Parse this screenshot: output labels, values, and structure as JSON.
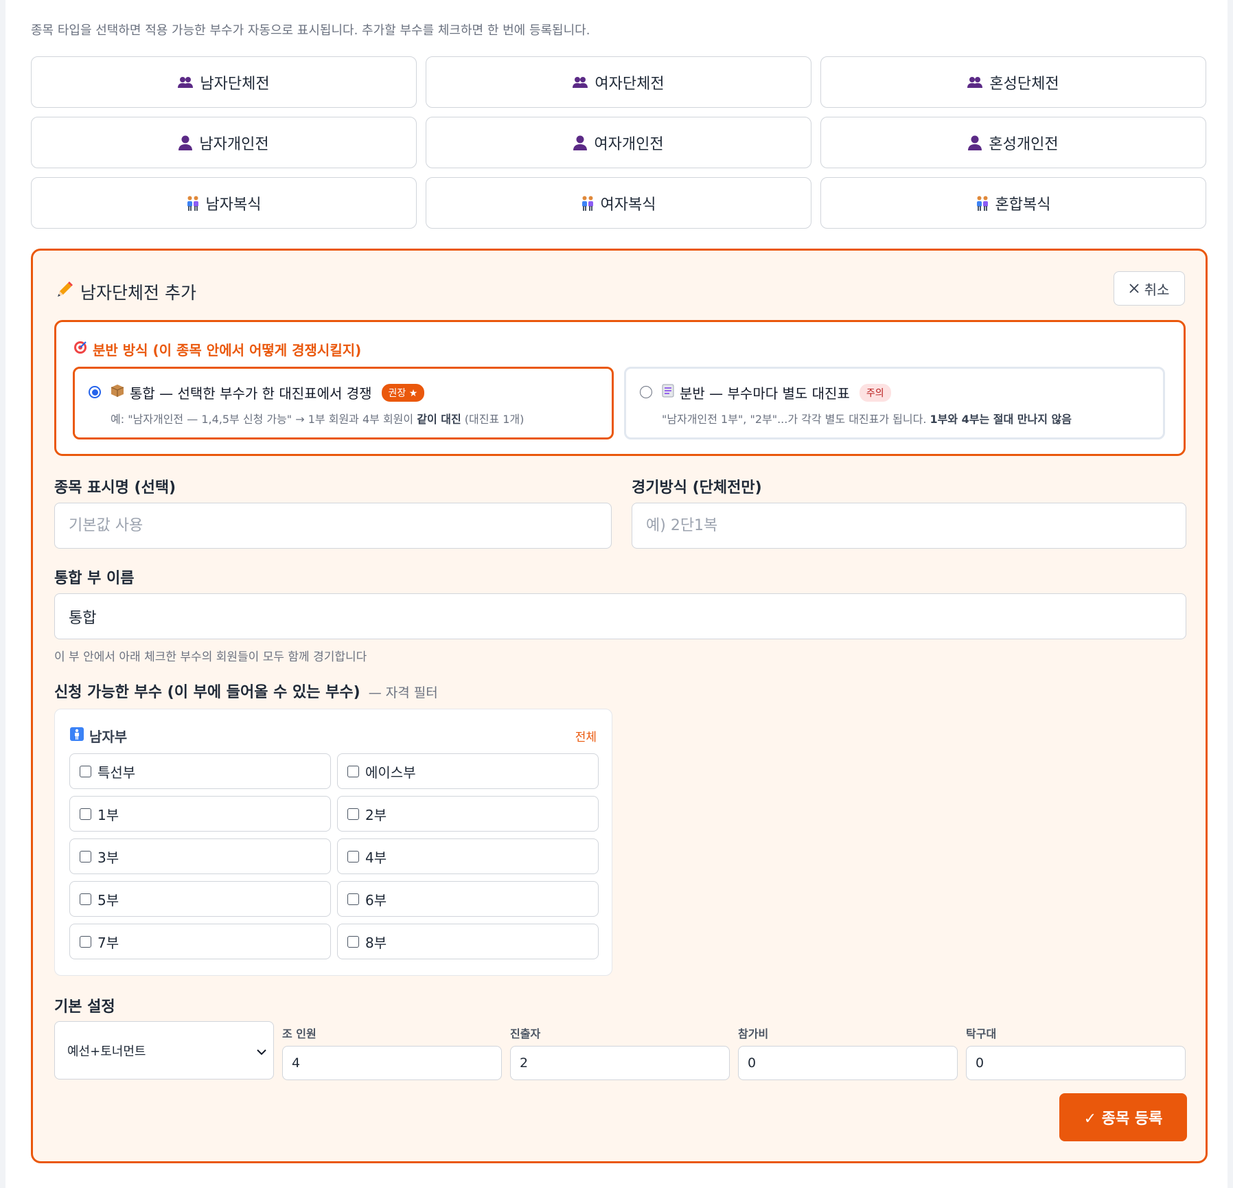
{
  "hint": "종목 타입을 선택하면 적용 가능한 부수가 자동으로 표시됩니다. 추가할 부수를 체크하면 한 번에 등록됩니다.",
  "event_types": [
    {
      "label": "남자단체전",
      "icon": "team-icon"
    },
    {
      "label": "여자단체전",
      "icon": "team-icon"
    },
    {
      "label": "혼성단체전",
      "icon": "team-icon"
    },
    {
      "label": "남자개인전",
      "icon": "person-icon"
    },
    {
      "label": "여자개인전",
      "icon": "person-icon"
    },
    {
      "label": "혼성개인전",
      "icon": "person-icon"
    },
    {
      "label": "남자복식",
      "icon": "pair-icon"
    },
    {
      "label": "여자복식",
      "icon": "pair-icon"
    },
    {
      "label": "혼합복식",
      "icon": "pair-icon"
    }
  ],
  "form": {
    "title": "남자단체전 추가",
    "cancel_label": "취소",
    "split": {
      "title": "분반 방식 (이 종목 안에서 어떻게 경쟁시킬지)",
      "option_a": {
        "head": "통합 — 선택한 부수가 한 대진표에서 경쟁",
        "badge": "권장 ★",
        "desc_pre": "예: \"남자개인전 — 1,4,5부 신청 가능\" → 1부 회원과 4부 회원이 ",
        "desc_bold": "같이 대진",
        "desc_post": " (대진표 1개)",
        "selected": true
      },
      "option_b": {
        "head": "분반 — 부수마다 별도 대진표",
        "badge": "주의",
        "desc_pre": "\"남자개인전 1부\", \"2부\"...가 각각 별도 대진표가 됩니다. ",
        "desc_bold": "1부와 4부는 절대 만나지 않음",
        "selected": false
      }
    },
    "display_name": {
      "label": "종목 표시명 (선택)",
      "placeholder": "기본값 사용",
      "value": ""
    },
    "match_format": {
      "label": "경기방식 (단체전만)",
      "placeholder": "예) 2단1복",
      "value": ""
    },
    "group_name": {
      "label": "통합 부 이름",
      "value": "통합",
      "help": "이 부 안에서 아래 체크한 부수의 회원들이 모두 함께 경기합니다"
    },
    "eligible": {
      "label": "신청 가능한 부수 (이 부에 들어올 수 있는 부수)",
      "sublabel": "— 자격 필터",
      "group_title": "남자부",
      "all_label": "전체",
      "divisions": [
        "특선부",
        "에이스부",
        "1부",
        "2부",
        "3부",
        "4부",
        "5부",
        "6부",
        "7부",
        "8부"
      ]
    },
    "basic": {
      "label": "기본 설정",
      "mode": "예선+토너먼트",
      "fields": [
        {
          "label": "조 인원",
          "value": "4"
        },
        {
          "label": "진출자",
          "value": "2"
        },
        {
          "label": "참가비",
          "value": "0"
        },
        {
          "label": "탁구대",
          "value": "0"
        }
      ]
    },
    "submit_label": "✓ 종목 등록"
  },
  "colors": {
    "accent": "#ea580c",
    "icon_purple": "#5b2a86"
  }
}
